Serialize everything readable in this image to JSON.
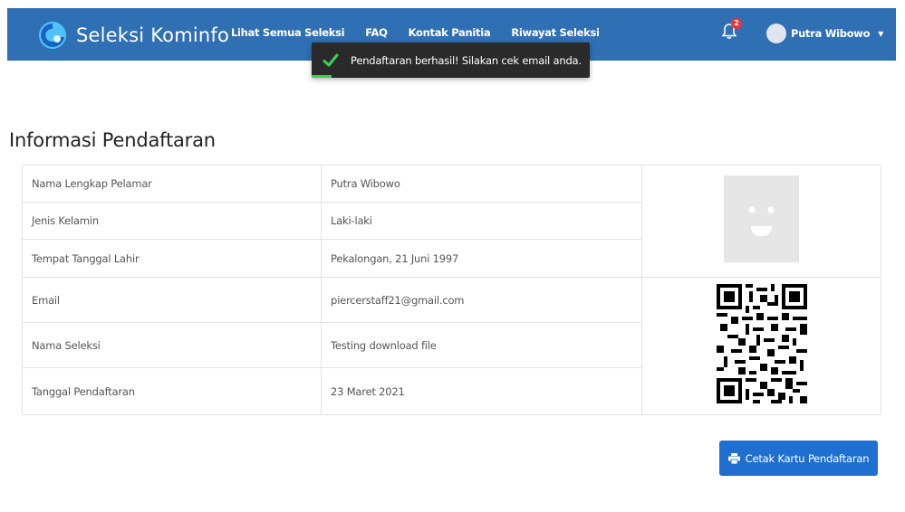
{
  "app": {
    "title": "Seleksi Kominfo"
  },
  "nav": {
    "items": [
      {
        "label": "Lihat Semua Seleksi"
      },
      {
        "label": "FAQ"
      },
      {
        "label": "Kontak Panitia"
      },
      {
        "label": "Riwayat Seleksi"
      }
    ]
  },
  "notifications": {
    "count": "2"
  },
  "user": {
    "name": "Putra Wibowo"
  },
  "toast": {
    "message": "Pendaftaran berhasil! Silakan cek email anda."
  },
  "page": {
    "heading": "Informasi Pendaftaran"
  },
  "info": {
    "rows": [
      {
        "label": "Nama Lengkap Pelamar",
        "value": "Putra Wibowo"
      },
      {
        "label": "Jenis Kelamin",
        "value": "Laki-laki"
      },
      {
        "label": "Tempat Tanggal Lahir",
        "value": "Pekalongan, 21 Juni 1997"
      },
      {
        "label": "Email",
        "value": "piercerstaff21@gmail.com"
      },
      {
        "label": "Nama Seleksi",
        "value": "Testing download file"
      },
      {
        "label": "Tanggal Pendaftaran",
        "value": "23 Maret 2021"
      }
    ]
  },
  "actions": {
    "print_label": "Cetak Kartu Pendaftaran"
  },
  "colors": {
    "navbar": "#2f6fb3",
    "primary_button": "#1f6fd1",
    "toast_bg": "#2a2a2a",
    "success": "#39d353",
    "badge": "#e53935"
  },
  "icons": {
    "logo": "kominfo-logo-icon",
    "bell": "bell-icon",
    "check": "check-icon",
    "print": "printer-icon",
    "caret": "caret-down-icon"
  }
}
